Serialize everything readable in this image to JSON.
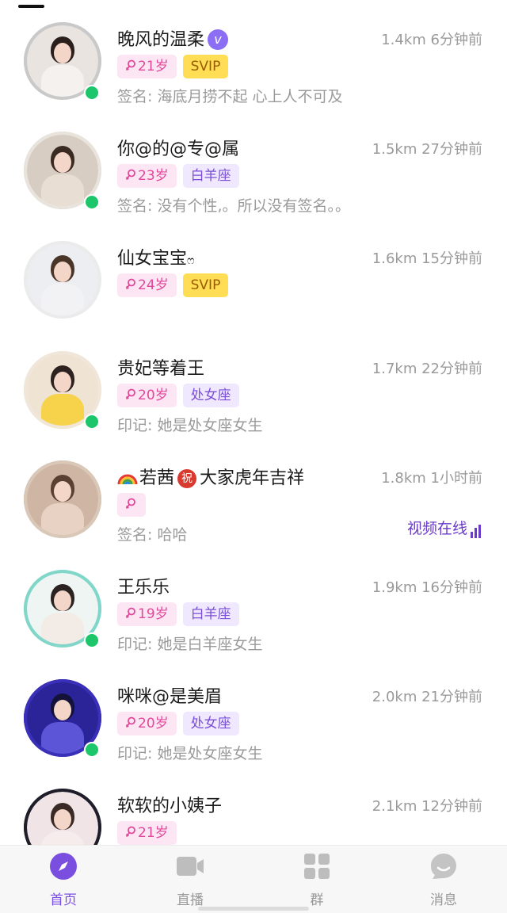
{
  "users": [
    {
      "name": "晚风的温柔",
      "badge": "v",
      "meta": "1.4km 6分钟前",
      "tags": [
        {
          "type": "gender",
          "text": "21岁"
        },
        {
          "type": "svip",
          "text": "SVIP"
        }
      ],
      "sign": "签名: 海底月捞不起   心上人不可及",
      "online": true,
      "ring_color": "#c9c9c9",
      "bg": "#e9e4e0",
      "hair": "#2a1f1c",
      "shirt": "#f4f1ee"
    },
    {
      "name": "你@的@专@属",
      "meta": "1.5km 27分钟前",
      "tags": [
        {
          "type": "gender",
          "text": "23岁"
        },
        {
          "type": "zodiac",
          "text": "白羊座"
        }
      ],
      "sign": "签名: 没有个性,。所以没有签名。。",
      "online": true,
      "ring_color": "#e8e3dc",
      "bg": "#d8cdc2",
      "hair": "#3b2a22",
      "shirt": "#e9ded3"
    },
    {
      "name": "仙女宝宝",
      "name_suffix": "ෆ",
      "meta": "1.6km 15分钟前",
      "tags": [
        {
          "type": "gender",
          "text": "24岁"
        },
        {
          "type": "svip",
          "text": "SVIP"
        }
      ],
      "sign": "",
      "online": false,
      "ring_color": "#ecebeb",
      "bg": "#eceef2",
      "hair": "#4a3628",
      "shirt": "#f2f2f4"
    },
    {
      "name": "贵妃等着王",
      "meta": "1.7km 22分钟前",
      "tags": [
        {
          "type": "gender",
          "text": "20岁"
        },
        {
          "type": "zodiac",
          "text": "处女座"
        }
      ],
      "sign": "印记: 她是处女座女生",
      "online": true,
      "ring_color": "#f0e6da",
      "bg": "#efe3d4",
      "hair": "#2d2220",
      "shirt": "#f6d34a"
    },
    {
      "name": "若茜",
      "name_zhu": "祝",
      "name_rest": "大家虎年吉祥",
      "meta": "1.8km 1小时前",
      "tags": [
        {
          "type": "gender",
          "text": ""
        }
      ],
      "sign": "签名: 哈哈",
      "video_online": "视频在线",
      "online": false,
      "ring_color": "#d9c7b8",
      "bg": "#cfb6a4",
      "hair": "#5a3f33",
      "shirt": "#e8d2c4"
    },
    {
      "name": "王乐乐",
      "meta": "1.9km 16分钟前",
      "tags": [
        {
          "type": "gender",
          "text": "19岁"
        },
        {
          "type": "zodiac",
          "text": "白羊座"
        }
      ],
      "sign": "印记: 她是白羊座女生",
      "online": true,
      "ring_color": "#7fd6c9",
      "bg": "#eef5f2",
      "hair": "#2a2322",
      "shirt": "#f3ebe6"
    },
    {
      "name": "咪咪@是美眉",
      "meta": "2.0km 21分钟前",
      "tags": [
        {
          "type": "gender",
          "text": "20岁"
        },
        {
          "type": "zodiac",
          "text": "处女座"
        }
      ],
      "sign": "印记: 她是处女座女生",
      "online": true,
      "ring_color": "#3a2fb8",
      "bg": "#2b2398",
      "hair": "#141238",
      "shirt": "#5d55d8"
    },
    {
      "name": "软软的小姨子",
      "meta": "2.1km 12分钟前",
      "tags": [
        {
          "type": "gender",
          "text": "21岁"
        }
      ],
      "sign": "",
      "online": false,
      "ring_color": "#1e1e2a",
      "bg": "#f1e4e6",
      "hair": "#3a2a26",
      "shirt": "#f5eceb"
    }
  ],
  "tabs": [
    {
      "label": "首页",
      "icon": "compass-icon",
      "active": true
    },
    {
      "label": "直播",
      "icon": "video-camera-icon",
      "active": false
    },
    {
      "label": "群",
      "icon": "grid-icon",
      "active": false
    },
    {
      "label": "消息",
      "icon": "chat-bubble-icon",
      "active": false
    }
  ],
  "colors": {
    "accent": "#7a4fe0",
    "online": "#1ec66b",
    "svip": "#ffdd55",
    "gender_tag": "#fde6f4",
    "zodiac_tag": "#efe8ff"
  }
}
